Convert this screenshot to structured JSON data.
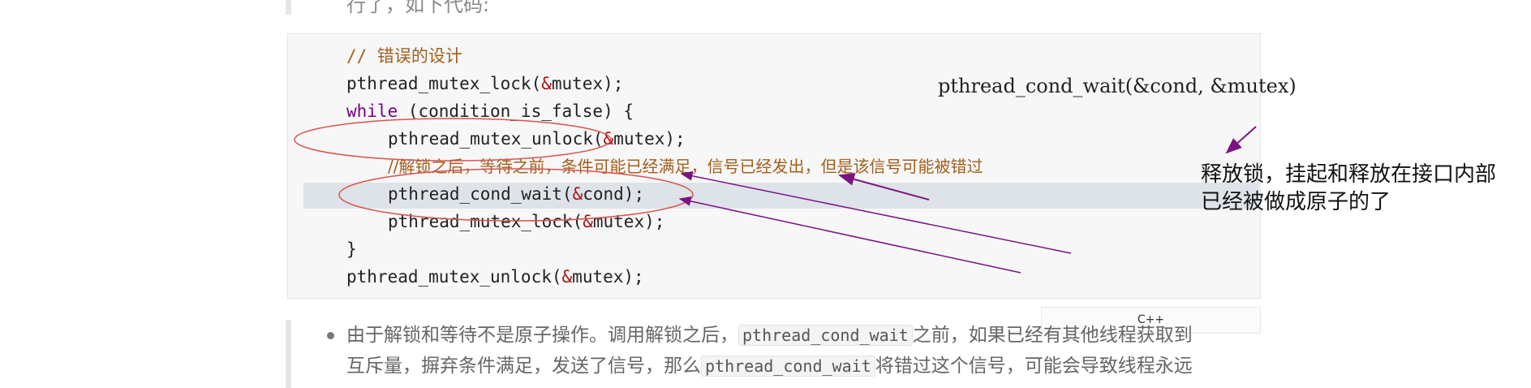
{
  "top_text": "行了，如下代码:",
  "code": {
    "lines": [
      {
        "text": "// 错误的设计"
      },
      {
        "pre": "pthread_mutex_lock(",
        "amp": "&",
        "post": "mutex);"
      },
      {
        "kw": "while",
        "rest": " (condition_is_false) {"
      },
      {
        "pre": "pthread_mutex_unlock(",
        "amp": "&",
        "post": "mutex);"
      },
      {
        "text": "//解锁之后，等待之前，条件可能已经满足，信号已经发出，但是该信号可能被错过"
      },
      {
        "pre": "pthread_cond_wait(",
        "amp": "&",
        "post": "cond);"
      },
      {
        "pre": "pthread_mutex_lock(",
        "amp": "&",
        "post": "mutex);"
      },
      {
        "text": "}"
      },
      {
        "pre": "pthread_mutex_unlock(",
        "amp": "&",
        "post": "mutex);"
      }
    ],
    "language": "C++"
  },
  "annotations": {
    "call": "pthread_cond_wait(&cond, &mutex)",
    "note_line1": "释放锁，挂起和释放在接口内部",
    "note_line2": "已经被做成原子的了"
  },
  "bullet": {
    "line1_a": "由于解锁和等待不是原子操作。调用解锁之后，",
    "line1_code": "pthread_cond_wait",
    "line1_b": "之前，如果已经有其他线程获取到",
    "line2_a": "互斥量，摒弃条件满足，发送了信号，那么",
    "line2_code": "pthread_cond_wait",
    "line2_b": "将错过这个信号，可能会导致线程永远"
  },
  "colors": {
    "comment": "#a35e1c",
    "keyword": "#770088",
    "ampersand": "#aa1111",
    "annotation_ellipse": "#d9534f",
    "annotation_arrow": "#7a1480"
  }
}
